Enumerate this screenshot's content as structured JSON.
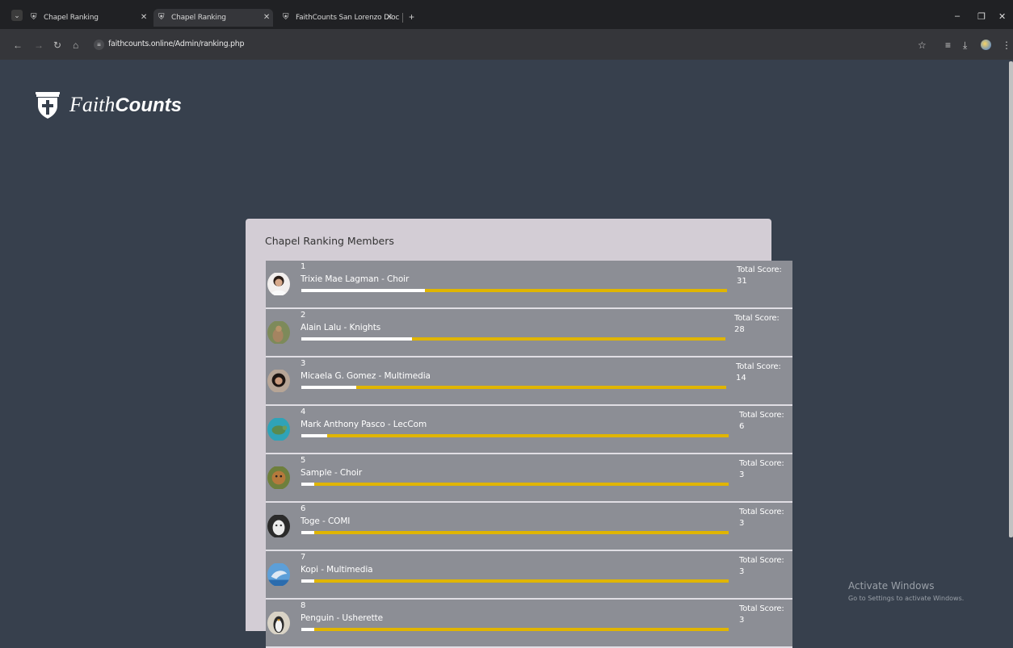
{
  "browser": {
    "tabs": [
      {
        "title": "Chapel Ranking",
        "active": false
      },
      {
        "title": "Chapel Ranking",
        "active": true
      },
      {
        "title": "FaithCounts San Lorenzo Dioc",
        "active": false
      }
    ],
    "url": "faithcounts.online/Admin/ranking.php"
  },
  "brand": {
    "part1": "Faith",
    "part2": "Counts"
  },
  "card": {
    "title": "Chapel Ranking Members"
  },
  "score_label": "Total Score:",
  "members": [
    {
      "rank": "1",
      "name": "Trixie Mae Lagman - Choir",
      "score": "31",
      "progress": 0.29,
      "avatar": "portrait-woman"
    },
    {
      "rank": "2",
      "name": "Alain Lalu - Knights",
      "score": "28",
      "progress": 0.26,
      "avatar": "squirrel"
    },
    {
      "rank": "3",
      "name": "Micaela G. Gomez - Multimedia",
      "score": "14",
      "progress": 0.13,
      "avatar": "portrait-girl"
    },
    {
      "rank": "4",
      "name": "Mark Anthony Pasco - LecCom",
      "score": "6",
      "progress": 0.06,
      "avatar": "sea-turtle"
    },
    {
      "rank": "5",
      "name": "Sample - Choir",
      "score": "3",
      "progress": 0.03,
      "avatar": "otter"
    },
    {
      "rank": "6",
      "name": "Toge - COMI",
      "score": "3",
      "progress": 0.03,
      "avatar": "white-cat"
    },
    {
      "rank": "7",
      "name": "Kopi - Multimedia",
      "score": "3",
      "progress": 0.03,
      "avatar": "dolphin"
    },
    {
      "rank": "8",
      "name": "Penguin - Usherette",
      "score": "3",
      "progress": 0.03,
      "avatar": "penguin"
    }
  ],
  "watermark": {
    "line1": "Activate Windows",
    "line2": "Go to Settings to activate Windows."
  },
  "colors": {
    "page_bg": "#37404d",
    "card_bg": "#d3cdd5",
    "row_bg": "#8c8e95",
    "bar_track": "#e0b500",
    "bar_fill": "#ffffff"
  }
}
